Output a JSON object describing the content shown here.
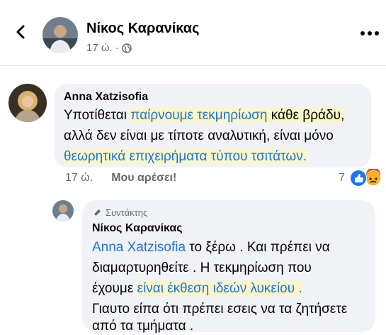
{
  "header": {
    "name": "Νίκος Καρανίκας",
    "time": "17 ώ.",
    "dot": "·"
  },
  "comment1": {
    "author": "Anna Xatzisofia",
    "line1_a": "Υποτίθεται ",
    "line1_b": "παίρνουμε τεκμηρίωση",
    "line1_c": " κάθε βράδυ,",
    "line2": "αλλά δεν είναι με τίποτε αναλυτική, είναι μόνο",
    "line3": "θεωρητικά επιχειρήματα τύπου τσιτάτων.",
    "time": "17 ώ.",
    "like_label": "Μου αρέσει!",
    "reaction_count": "7"
  },
  "comment2": {
    "badge": "Συντάκτης",
    "author": "Νίκος Καρανίκας",
    "mention": "Anna Xatzisofia",
    "line1_rest": " το ξέρω . Και πρέπει να",
    "line2": "διαμαρτυρηθείτε . Η τεκμηρίωση που",
    "line3_a": "έχουμε ",
    "line3_b": "είναι έκθεση ιδεών λυκείου .",
    "line4": "Γιαυτο είπα ότι πρέπει εσεις να τα ζητήσετε",
    "line5": "από τα τμήματα ."
  },
  "colors": {
    "bubble": "#f0f2f5",
    "link": "#1b74e4",
    "highlight": "#fbf6c7",
    "meta": "#65676b"
  }
}
